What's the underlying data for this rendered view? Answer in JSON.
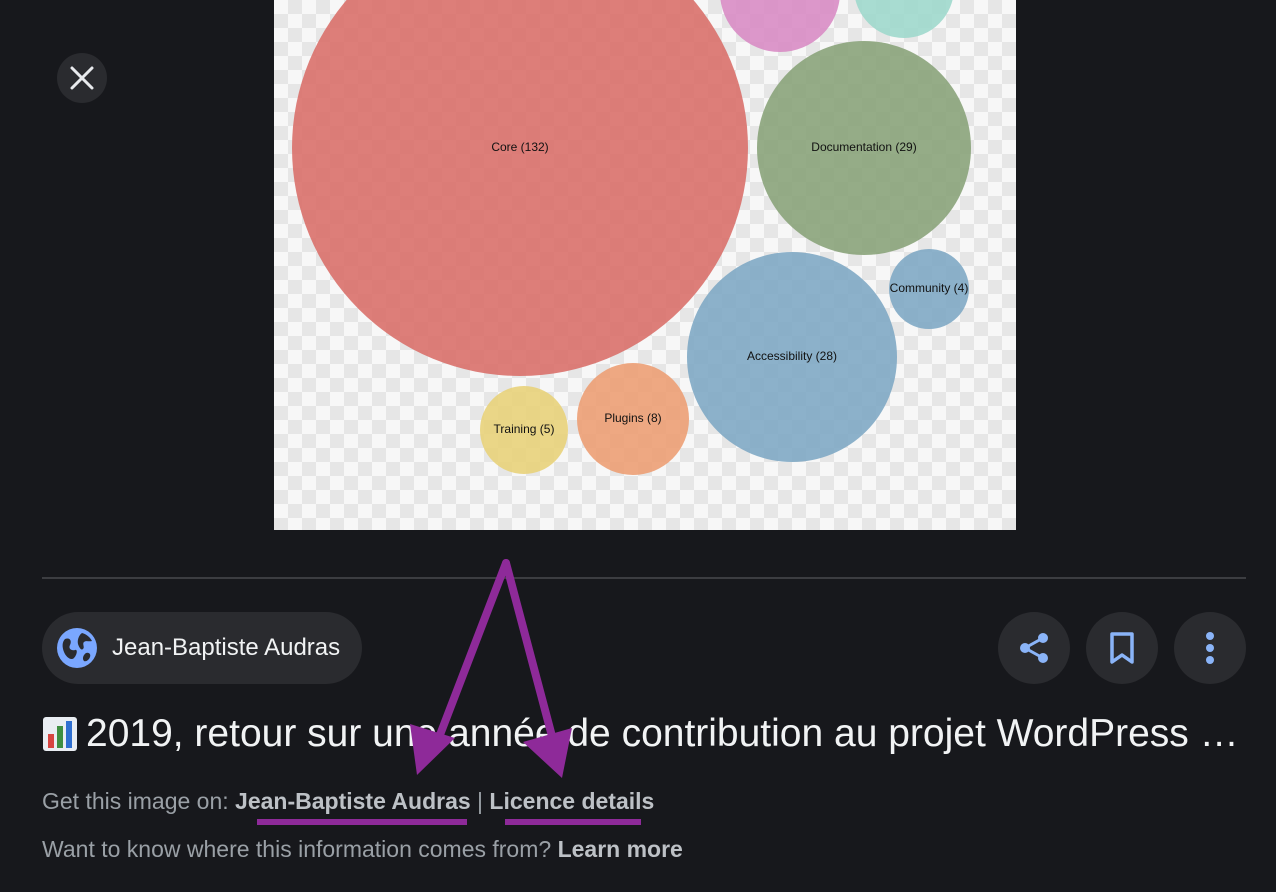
{
  "chart_data": {
    "type": "bubble",
    "bubbles": [
      {
        "label": "Core (132)",
        "color": "#d9706a"
      },
      {
        "label": "Documentation (29)",
        "color": "#8aa37a"
      },
      {
        "label": "Accessibility (28)",
        "color": "#7fa8c4"
      },
      {
        "label": "Community (4)",
        "color": "#7fa8c4"
      },
      {
        "label": "Training (5)",
        "color": "#e8d27a"
      },
      {
        "label": "Plugins (8)",
        "color": "#ec9e74"
      },
      {
        "label": "",
        "color": "#d88cc4"
      },
      {
        "label": "",
        "color": "#9fd8cc"
      }
    ]
  },
  "source": {
    "name": "Jean-Baptiste Audras"
  },
  "actions": {
    "share": "share-icon",
    "save": "bookmark-icon",
    "more": "more-vert-icon"
  },
  "title": "2019, retour sur une année de contribution au projet WordPress …",
  "get_image": {
    "prefix": "Get this image on:",
    "site": "Jean-Baptiste Audras",
    "separator": "|",
    "licence": "Licence details"
  },
  "info": {
    "text": "Want to know where this information comes from?",
    "link": "Learn more"
  },
  "annotation_color": "#8e2a99"
}
